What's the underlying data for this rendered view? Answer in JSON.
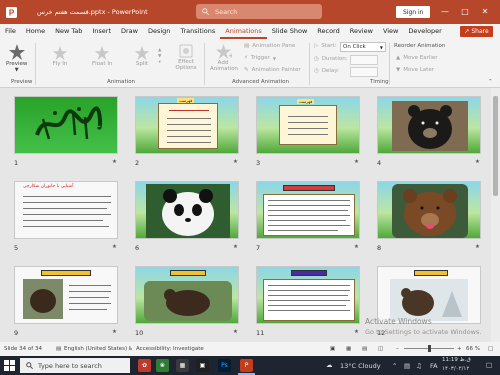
{
  "window": {
    "title": "قسمت هفتم خرس.pptx - PowerPoint",
    "search_placeholder": "Search",
    "signin_label": "Sign in"
  },
  "tabs": [
    "File",
    "Home",
    "New Tab",
    "Insert",
    "Draw",
    "Design",
    "Transitions",
    "Animations",
    "Slide Show",
    "Record",
    "Review",
    "View",
    "Developer"
  ],
  "active_tab": "Animations",
  "share_label": "Share",
  "ribbon": {
    "preview_label": "Preview",
    "preview_group": "Preview",
    "effects": [
      "Fly In",
      "Float In",
      "Split"
    ],
    "effect_options_label": "Effect Options",
    "animation_group": "Animation",
    "add_animation_label": "Add Animation",
    "animation_pane_label": "Animation Pane",
    "trigger_label": "Trigger",
    "animation_painter_label": "Animation Painter",
    "advanced_group": "Advanced Animation",
    "start_label": "Start:",
    "start_value": "On Click",
    "duration_label": "Duration:",
    "delay_label": "Delay:",
    "timing_group": "Timing",
    "reorder_label": "Reorder Animation",
    "move_earlier_label": "Move Earlier",
    "move_later_label": "Move Later"
  },
  "slides": [
    {
      "num": "1",
      "kind": "calligraphy"
    },
    {
      "num": "2",
      "kind": "text-yellow",
      "heading": "فهرست"
    },
    {
      "num": "3",
      "kind": "text-yellow",
      "heading": "فهرست"
    },
    {
      "num": "4",
      "kind": "photo-bear-black"
    },
    {
      "num": "5",
      "kind": "text-list",
      "heading": "آشنایی با جانوران شکارچی"
    },
    {
      "num": "6",
      "kind": "photo-panda"
    },
    {
      "num": "7",
      "kind": "text-dense"
    },
    {
      "num": "8",
      "kind": "photo-bear-brown"
    },
    {
      "num": "9",
      "kind": "text-badge"
    },
    {
      "num": "10",
      "kind": "photo-bear-nature"
    },
    {
      "num": "11",
      "kind": "text-columns"
    },
    {
      "num": "12",
      "kind": "photo-bear-snow"
    }
  ],
  "status": {
    "slide_info": "Slide 34 of 34",
    "language": "English (United States)",
    "accessibility": "Accessibility: Investigate",
    "zoom": "66 %"
  },
  "watermark": {
    "line1": "Activate Windows",
    "line2": "Go to Settings to activate Windows."
  },
  "taskbar": {
    "search_placeholder": "Type here to search",
    "weather": "13°C  Cloudy",
    "language": "FA",
    "time": "11:19 ق.ظ",
    "date": "۱۴۰۳/۰۲/۱۲"
  },
  "colors": {
    "accent": "#b7472a",
    "ribbon_bg": "#f3f3f3",
    "taskbar_bg": "#1f2530"
  }
}
